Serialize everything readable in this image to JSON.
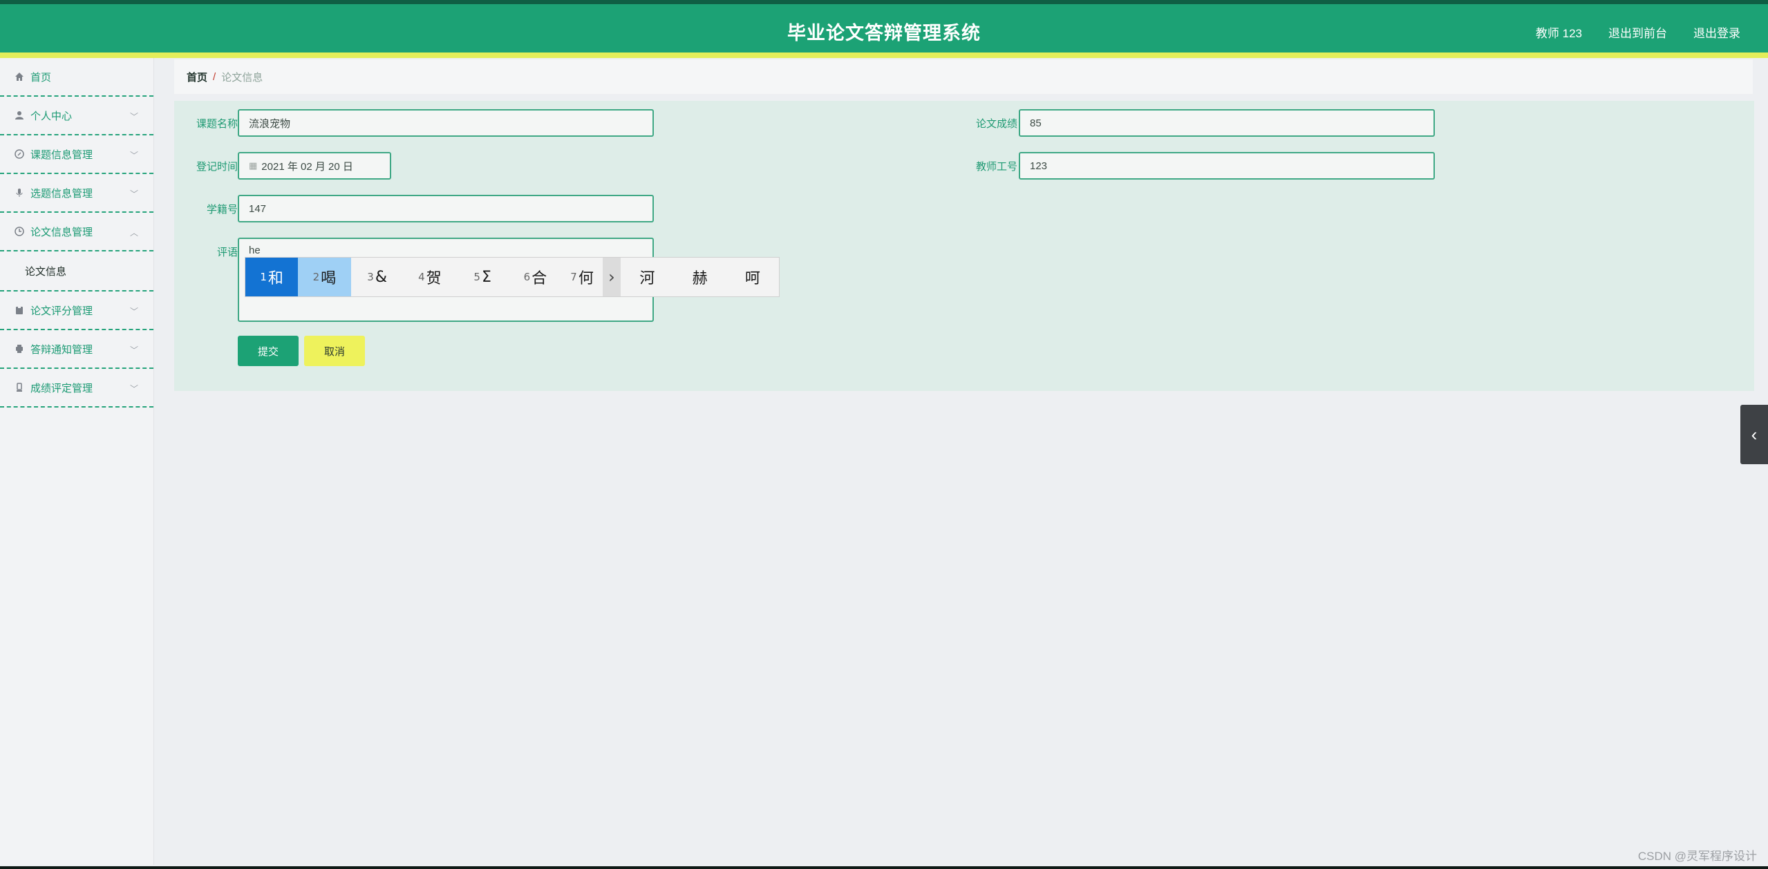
{
  "header": {
    "title": "毕业论文答辩管理系统",
    "user_label": "教师 123",
    "back_front_label": "退出到前台",
    "logout_label": "退出登录"
  },
  "sidebar": {
    "items": [
      {
        "label": "首页",
        "icon": "home-icon"
      },
      {
        "label": "个人中心",
        "icon": "user-icon"
      },
      {
        "label": "课题信息管理",
        "icon": "compass-icon"
      },
      {
        "label": "选题信息管理",
        "icon": "mic-icon"
      },
      {
        "label": "论文信息管理",
        "icon": "clock-icon"
      },
      {
        "label": "论文评分管理",
        "icon": "clipboard-icon"
      },
      {
        "label": "答辩通知管理",
        "icon": "printer-icon"
      },
      {
        "label": "成绩评定管理",
        "icon": "badge-icon"
      }
    ],
    "submenu": {
      "label": "论文信息"
    }
  },
  "breadcrumb": {
    "home": "首页",
    "separator": "/",
    "current": "论文信息"
  },
  "form": {
    "topic_name": {
      "label": "课题名称",
      "value": "流浪宠物"
    },
    "thesis_score": {
      "label": "论文成绩",
      "value": "85"
    },
    "register_time": {
      "label": "登记时间",
      "value": "2021 年 02 月 20 日"
    },
    "teacher_id": {
      "label": "教师工号",
      "value": "123"
    },
    "student_id": {
      "label": "学籍号",
      "value": "147"
    },
    "comment": {
      "label": "评语",
      "value": "he"
    },
    "submit_label": "提交",
    "cancel_label": "取消"
  },
  "ime": {
    "candidates": [
      {
        "num": "1",
        "char": "和"
      },
      {
        "num": "2",
        "char": "喝"
      },
      {
        "num": "3",
        "char": "&"
      },
      {
        "num": "4",
        "char": "贺"
      },
      {
        "num": "5",
        "char": "Σ"
      },
      {
        "num": "6",
        "char": "合"
      },
      {
        "num": "7",
        "char": "何"
      }
    ],
    "more_label": "›",
    "extra": [
      "河",
      "赫",
      "呵"
    ]
  },
  "side_toggle_label": "‹",
  "watermark": "CSDN @灵军程序设计",
  "colors": {
    "primary": "#1ca275",
    "accent_stripe": "#e3ee5a",
    "cancel": "#eef25c",
    "ime_selected": "#1373d3"
  }
}
